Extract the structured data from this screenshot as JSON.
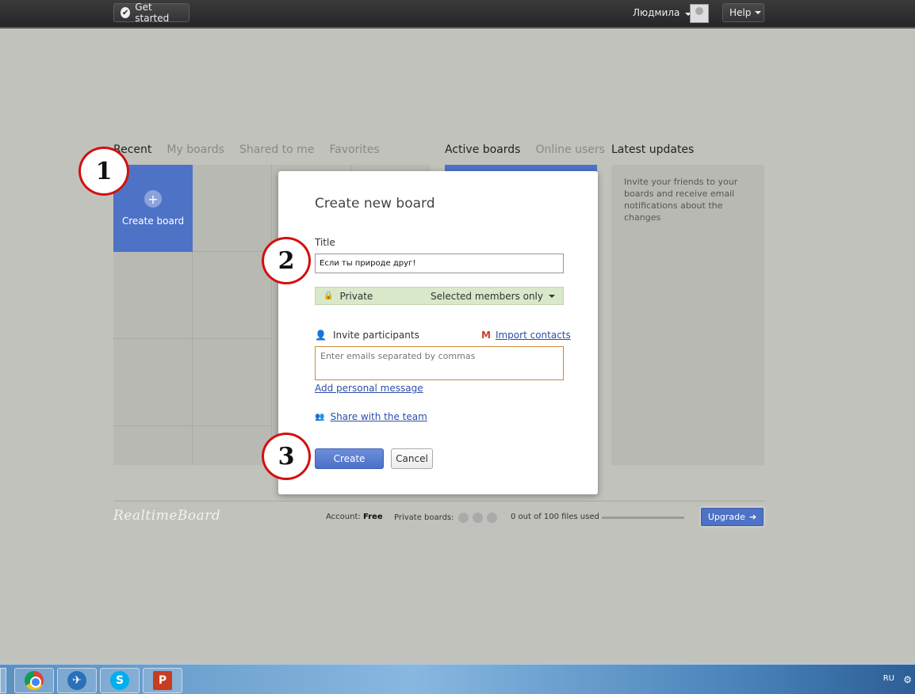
{
  "topbar": {
    "get_started": "Get started",
    "user_name": "Людмила",
    "help": "Help"
  },
  "tabs_left": [
    {
      "label": "Recent",
      "active": true
    },
    {
      "label": "My boards",
      "active": false
    },
    {
      "label": "Shared to me",
      "active": false
    },
    {
      "label": "Favorites",
      "active": false
    }
  ],
  "tabs_right": [
    {
      "label": "Active boards",
      "active": true
    },
    {
      "label": "Online users",
      "active": false
    }
  ],
  "latest_updates": {
    "title": "Latest updates",
    "text": "Invite your friends to your boards and receive email notifications about the changes"
  },
  "create_board": {
    "label": "Create board",
    "icon": "plus-icon"
  },
  "dialog": {
    "title": "Create new board",
    "title_label": "Title",
    "title_value": "Если ты природе друг!",
    "privacy_label": "Private",
    "privacy_option": "Selected members only",
    "invite_label": "Invite participants",
    "import_contacts": "Import contacts",
    "emails_placeholder": "Enter emails separated by commas",
    "add_message": "Add personal message",
    "share_team": "Share with the team",
    "create": "Create",
    "cancel": "Cancel"
  },
  "markers": [
    "1",
    "2",
    "3"
  ],
  "footer": {
    "logo": "RealtimeBoard",
    "account_label": "Account:",
    "account_value": "Free",
    "private_boards_label": "Private boards:",
    "files_used": "0 out of 100 files used",
    "files_progress": 0,
    "upgrade": "Upgrade"
  },
  "taskbar": {
    "apps": [
      "chrome-icon",
      "thunderbird-icon",
      "skype-icon",
      "powerpoint-icon"
    ],
    "skype_letter": "S",
    "ppt_letter": "P",
    "language": "RU"
  },
  "colors": {
    "accent": "#4e72c6",
    "background": "#c2c2bc",
    "marker_border": "#d21010"
  }
}
